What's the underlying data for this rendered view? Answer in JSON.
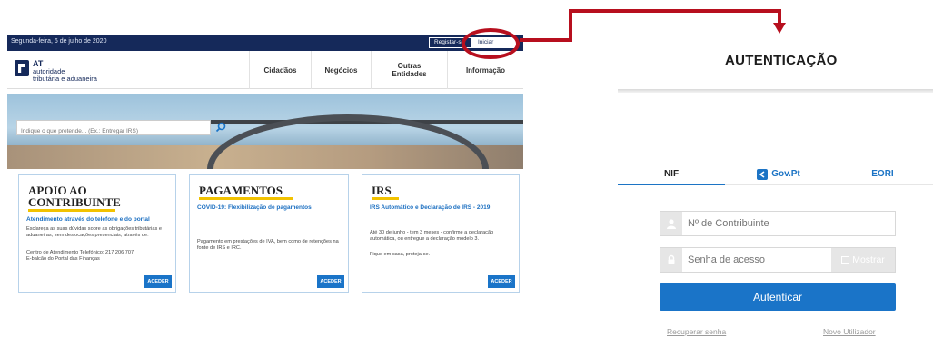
{
  "portal": {
    "topbar": {
      "date": "Segunda-feira, 6 de julho de 2020",
      "registar": "Registar-se",
      "iniciar": "Iniciar Sessão"
    },
    "logo": {
      "line1": "AT",
      "line2": "autoridade",
      "line3": "tributária e aduaneira"
    },
    "nav": {
      "cidadaos": "Cidadãos",
      "negocios": "Negócios",
      "outras": "Outras Entidades",
      "informacao": "Informação"
    },
    "search": {
      "placeholder": "Indique o que pretende... (Ex.: Entregar IRS)"
    },
    "cards": [
      {
        "title_line1": "APOIO AO",
        "title_line2": "CONTRIBUINTE",
        "subtitle": "Atendimento através do telefone e do portal",
        "text1": "Esclareça as suas dúvidas sobre as obrigações tributárias e aduaneiras, sem deslocações presenciais, através de:",
        "text2": "Centro de Atendimento Telefónico: 217 206 707",
        "text3": "E-balcão do Portal das Finanças",
        "button": "ACEDER"
      },
      {
        "title_line1": "PAGAMENTOS",
        "subtitle": "COVID-19: Flexibilização de pagamentos",
        "text1": "Pagamento em prestações de IVA, bem como de retenções na fonte de IRS e IRC.",
        "button": "ACEDER"
      },
      {
        "title_line1": "IRS",
        "subtitle": "IRS Automático e Declaração de IRS - 2019",
        "text1": "Até 30 de junho - tem 3 meses - confirme a declaração automática, ou entregue a declaração modelo 3.",
        "text2": "Fique em casa, proteja-se.",
        "button": "ACEDER"
      }
    ]
  },
  "auth": {
    "title": "AUTENTICAÇÃO",
    "tabs": {
      "nif": "NIF",
      "gov": "Gov.Pt",
      "eori": "EORI"
    },
    "nif_placeholder": "Nº de Contribuinte",
    "pwd_placeholder": "Senha de acesso",
    "mostrar": "Mostrar",
    "submit": "Autenticar",
    "recuperar": "Recuperar senha",
    "novo": "Novo Utilizador"
  },
  "colors": {
    "navy": "#15295a",
    "accent_blue": "#1a74c8",
    "highlight_red": "#b70f1e",
    "yellow": "#f2c200"
  },
  "icons": {
    "search": "search-icon",
    "user": "user-icon",
    "lock": "lock-icon",
    "gov": "gov-pt-icon"
  }
}
